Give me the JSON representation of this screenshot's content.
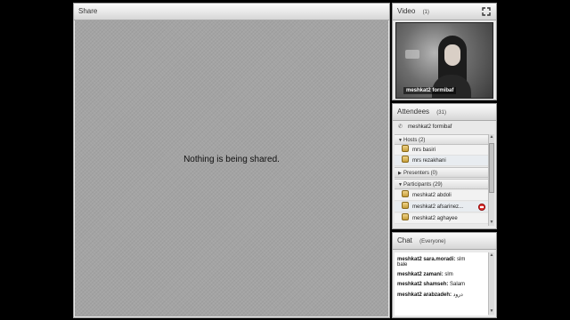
{
  "share": {
    "title": "Share",
    "message": "Nothing is being shared."
  },
  "video": {
    "title": "Video",
    "count": "(1)",
    "participant_name": "meshkat2 formibaf"
  },
  "attendees": {
    "title": "Attendees",
    "count": "(31)",
    "self": "meshkat2 formibaf",
    "groups": {
      "hosts": {
        "label": "Hosts (2)",
        "items": [
          "mrs basiri",
          "mrs rezakhani"
        ]
      },
      "presenters": {
        "label": "Presenters (0)"
      },
      "participants": {
        "label": "Participants (29)",
        "items": [
          "meshkat2 abdoli",
          "meshkat2 afsarinez...",
          "meshkat2 aghayee"
        ]
      }
    }
  },
  "chat": {
    "title": "Chat",
    "scope": "(Everyone)",
    "messages": [
      {
        "name": "meshkat2 sara.moradi:",
        "text": "slm",
        "extra": "bale"
      },
      {
        "name": "meshkat2 zamani:",
        "text": "slm"
      },
      {
        "name": "meshkat2 shamseh:",
        "text": "Salam"
      },
      {
        "name": "meshkat2 arabzadeh:",
        "text": "درود"
      }
    ]
  }
}
